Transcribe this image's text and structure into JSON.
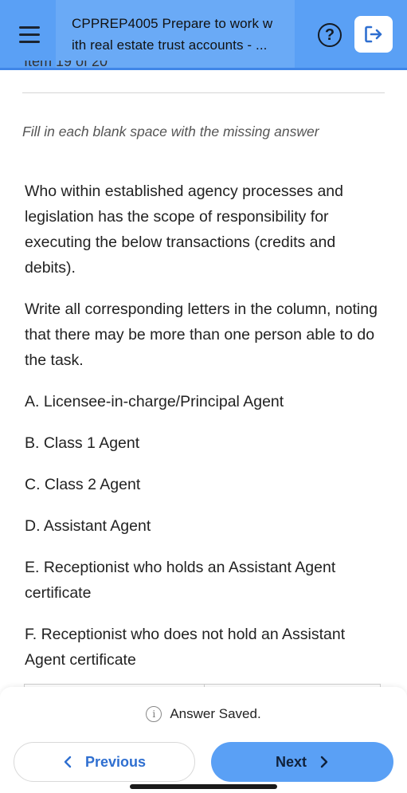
{
  "header": {
    "title_line1": "CPPREP4005 Prepare to work w",
    "title_line2": "ith real estate trust accounts - ...",
    "help_symbol": "?",
    "menu_icon": "hamburger-menu-icon",
    "exit_icon": "logout-icon"
  },
  "content": {
    "item_counter": "Item 19 of 20",
    "instruction": "Fill in each blank space with the missing answer",
    "question_p1": "Who within established agency processes and legislation has the scope of responsibility for executing the below transactions (credits and debits).",
    "question_p2": "Write all corresponding letters in the column, noting that there may be more than one person able to do the task.",
    "options": [
      "A. Licensee-in-charge/Principal Agent",
      "B. Class 1 Agent",
      "C. Class 2 Agent",
      "D. Assistant Agent",
      "E. Receptionist who holds an Assistant Agent certificate",
      "F. Receptionist who does not hold an Assistant Agent certificate"
    ]
  },
  "footer": {
    "saved_text": "Answer Saved.",
    "previous_label": "Previous",
    "next_label": "Next"
  },
  "colors": {
    "header_bg": "#5aa0f5",
    "primary_button": "#5aa0f5",
    "link_blue": "#2f6fd0"
  }
}
